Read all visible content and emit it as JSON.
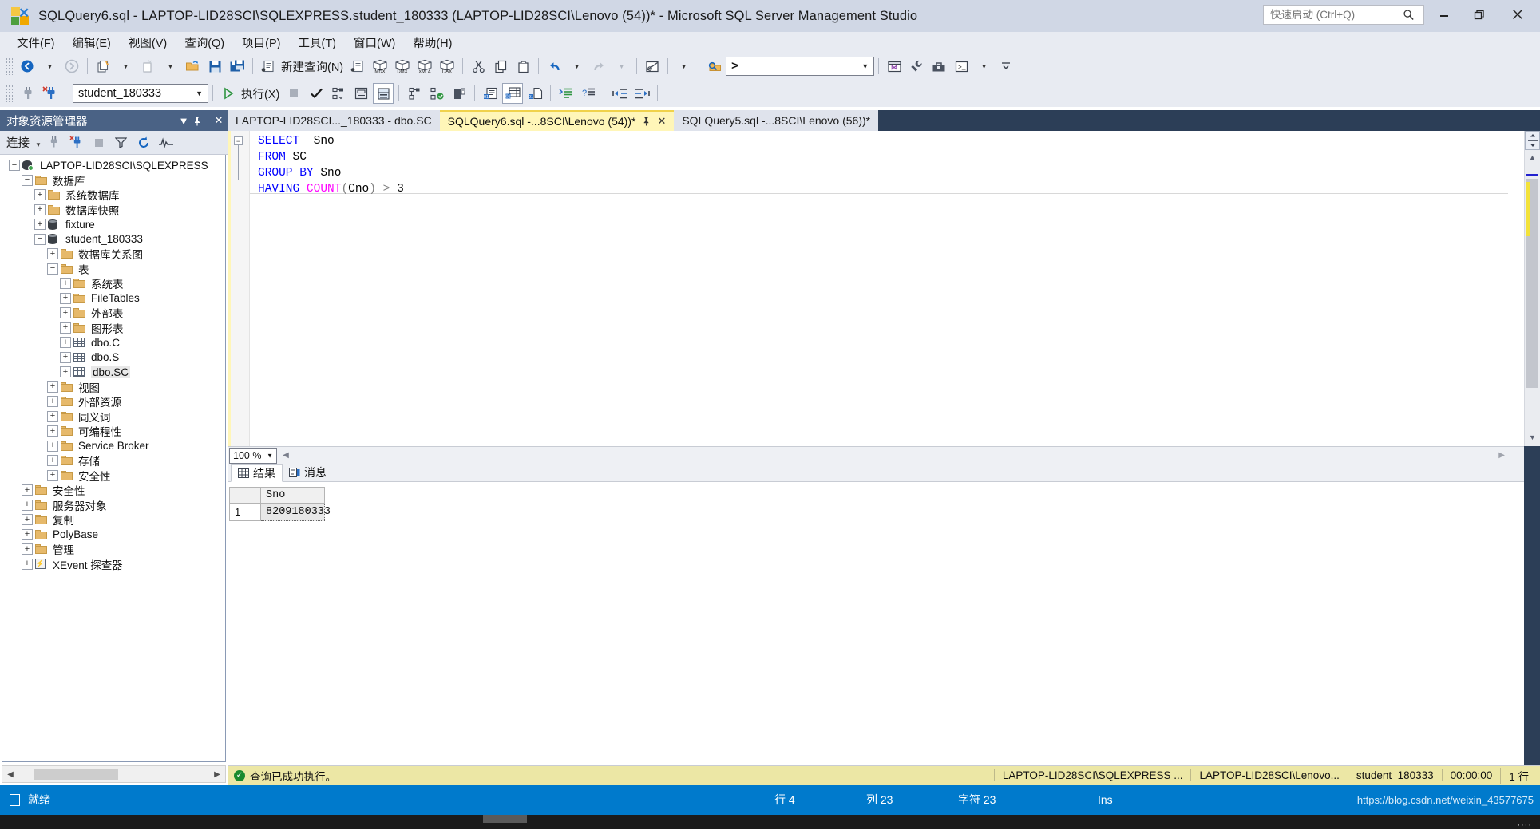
{
  "window": {
    "title": "SQLQuery6.sql - LAPTOP-LID28SCI\\SQLEXPRESS.student_180333 (LAPTOP-LID28SCI\\Lenovo (54))* - Microsoft SQL Server Management Studio",
    "minimize_label": "–",
    "maximize_label": "❐",
    "close_label": "✕"
  },
  "quick_launch": {
    "placeholder": "快速启动 (Ctrl+Q)",
    "value": "",
    "icon": "search-icon"
  },
  "menu": {
    "items": [
      {
        "label": "文件(F)"
      },
      {
        "label": "编辑(E)"
      },
      {
        "label": "视图(V)"
      },
      {
        "label": "查询(Q)"
      },
      {
        "label": "项目(P)"
      },
      {
        "label": "工具(T)"
      },
      {
        "label": "窗口(W)"
      },
      {
        "label": "帮助(H)"
      }
    ]
  },
  "toolbar_main": {
    "new_query_label": "新建查询(N)",
    "command_combo_value": ">",
    "icons": [
      "navigate-back-icon",
      "navigate-forward-icon",
      "new-project-icon",
      "new-item-icon",
      "open-file-icon",
      "save-icon",
      "save-all-icon",
      "new-query-icon",
      "new-analysis-query-icon",
      "new-mdx-query-icon",
      "new-dmx-query-icon",
      "new-xmla-query-icon",
      "new-dax-query-icon",
      "cut-icon",
      "copy-icon",
      "paste-icon",
      "undo-icon",
      "redo-icon",
      "find-in-files-icon",
      "solution-explorer-icon",
      "properties-window-icon",
      "toolbox-icon",
      "command-window-icon"
    ]
  },
  "toolbar_query": {
    "database_combo_value": "student_180333",
    "execute_label": "执行(X)",
    "icons": [
      "connect-icon",
      "disconnect-icon",
      "execute-icon",
      "stop-icon",
      "parse-icon",
      "display-estimated-plan-icon",
      "query-options-icon",
      "include-actual-plan-icon",
      "include-client-statistics-icon",
      "include-live-stats-icon",
      "results-to-text-icon",
      "results-to-grid-icon",
      "results-to-file-icon",
      "comment-icon",
      "uncomment-icon",
      "decrease-indent-icon",
      "increase-indent-icon"
    ]
  },
  "object_explorer": {
    "title": "对象资源管理器",
    "header_buttons": [
      "chevron-down-icon",
      "pin-icon",
      "close-icon"
    ],
    "connect_label": "连接",
    "toolbar_icons": [
      "connect-object-icon",
      "disconnect-object-icon",
      "stop-icon",
      "filter-icon",
      "refresh-icon",
      "activity-monitor-icon"
    ],
    "tree": [
      {
        "label": "LAPTOP-LID28SCI\\SQLEXPRESS",
        "indent": 0,
        "expander": "minus",
        "icon": "server-icon"
      },
      {
        "label": "数据库",
        "indent": 1,
        "expander": "minus",
        "icon": "folder-icon"
      },
      {
        "label": "系统数据库",
        "indent": 2,
        "expander": "plus",
        "icon": "folder-icon"
      },
      {
        "label": "数据库快照",
        "indent": 2,
        "expander": "plus",
        "icon": "folder-icon"
      },
      {
        "label": "fixture",
        "indent": 2,
        "expander": "plus",
        "icon": "database-icon"
      },
      {
        "label": "student_180333",
        "indent": 2,
        "expander": "minus",
        "icon": "database-icon"
      },
      {
        "label": "数据库关系图",
        "indent": 3,
        "expander": "plus",
        "icon": "folder-icon"
      },
      {
        "label": "表",
        "indent": 3,
        "expander": "minus",
        "icon": "folder-icon"
      },
      {
        "label": "系统表",
        "indent": 4,
        "expander": "plus",
        "icon": "folder-icon"
      },
      {
        "label": "FileTables",
        "indent": 4,
        "expander": "plus",
        "icon": "folder-icon"
      },
      {
        "label": "外部表",
        "indent": 4,
        "expander": "plus",
        "icon": "folder-icon"
      },
      {
        "label": "图形表",
        "indent": 4,
        "expander": "plus",
        "icon": "folder-icon"
      },
      {
        "label": "dbo.C",
        "indent": 4,
        "expander": "plus",
        "icon": "table-icon"
      },
      {
        "label": "dbo.S",
        "indent": 4,
        "expander": "plus",
        "icon": "table-icon"
      },
      {
        "label": "dbo.SC",
        "indent": 4,
        "expander": "plus",
        "icon": "table-icon",
        "selected": true
      },
      {
        "label": "视图",
        "indent": 3,
        "expander": "plus",
        "icon": "folder-icon"
      },
      {
        "label": "外部资源",
        "indent": 3,
        "expander": "plus",
        "icon": "folder-icon"
      },
      {
        "label": "同义词",
        "indent": 3,
        "expander": "plus",
        "icon": "folder-icon"
      },
      {
        "label": "可编程性",
        "indent": 3,
        "expander": "plus",
        "icon": "folder-icon"
      },
      {
        "label": "Service Broker",
        "indent": 3,
        "expander": "plus",
        "icon": "folder-icon"
      },
      {
        "label": "存储",
        "indent": 3,
        "expander": "plus",
        "icon": "folder-icon"
      },
      {
        "label": "安全性",
        "indent": 3,
        "expander": "plus",
        "icon": "folder-icon"
      },
      {
        "label": "安全性",
        "indent": 1,
        "expander": "plus",
        "icon": "folder-icon"
      },
      {
        "label": "服务器对象",
        "indent": 1,
        "expander": "plus",
        "icon": "folder-icon"
      },
      {
        "label": "复制",
        "indent": 1,
        "expander": "plus",
        "icon": "folder-icon"
      },
      {
        "label": "PolyBase",
        "indent": 1,
        "expander": "plus",
        "icon": "folder-icon"
      },
      {
        "label": "管理",
        "indent": 1,
        "expander": "plus",
        "icon": "folder-icon"
      },
      {
        "label": "XEvent 探查器",
        "indent": 1,
        "expander": "plus",
        "icon": "xevent-icon"
      }
    ]
  },
  "editor": {
    "tabs": [
      {
        "label": "LAPTOP-LID28SCI..._180333 - dbo.SC",
        "active": false,
        "closable": false
      },
      {
        "label": "SQLQuery6.sql -...8SCI\\Lenovo (54))*",
        "active": true,
        "closable": true,
        "pin": "✕"
      },
      {
        "label": "SQLQuery5.sql -...8SCI\\Lenovo (56))*",
        "active": false,
        "closable": false
      }
    ],
    "code_lines": [
      {
        "tokens": [
          {
            "t": "SELECT",
            "c": "kw"
          },
          {
            "t": "  Sno",
            "c": "ident"
          }
        ],
        "fold": true
      },
      {
        "tokens": [
          {
            "t": "FROM",
            "c": "kw"
          },
          {
            "t": " SC",
            "c": "ident"
          }
        ]
      },
      {
        "tokens": [
          {
            "t": "GROUP BY",
            "c": "kw"
          },
          {
            "t": " Sno",
            "c": "ident"
          }
        ]
      },
      {
        "tokens": [
          {
            "t": "HAVING",
            "c": "kw"
          },
          {
            "t": " ",
            "c": "ident"
          },
          {
            "t": "COUNT",
            "c": "fn"
          },
          {
            "t": "(",
            "c": "op"
          },
          {
            "t": "Cno",
            "c": "ident"
          },
          {
            "t": ")",
            "c": "op"
          },
          {
            "t": " > ",
            "c": "op"
          },
          {
            "t": "3",
            "c": "ident"
          }
        ],
        "caret": true
      }
    ],
    "zoom_value": "100 %"
  },
  "results": {
    "tabs": [
      {
        "label": "结果",
        "icon": "grid-icon",
        "active": true
      },
      {
        "label": "消息",
        "icon": "messages-icon",
        "active": false
      }
    ],
    "columns": [
      "",
      "Sno"
    ],
    "rows": [
      {
        "num": "1",
        "values": [
          "8209180333"
        ]
      }
    ]
  },
  "result_status": {
    "message": "查询已成功执行。",
    "server": "LAPTOP-LID28SCI\\SQLEXPRESS ...",
    "user": "LAPTOP-LID28SCI\\Lenovo...",
    "database": "student_180333",
    "elapsed": "00:00:00",
    "rowcount": "1 行"
  },
  "status_bar": {
    "ready": "就绪",
    "line": "行 4",
    "column": "列 23",
    "char": "字符 23",
    "insert_mode": "Ins",
    "watermark": "https://blog.csdn.net/weixin_43577675"
  },
  "colors": {
    "title_bar": "#d0d7e5",
    "menu_bar": "#e8ebf2",
    "oe_header": "#4a6285",
    "tab_active": "#fff6b8",
    "status_bar": "#007acc",
    "result_status": "#ece7a5",
    "keyword": "#0000ff",
    "function": "#ff00ff"
  }
}
